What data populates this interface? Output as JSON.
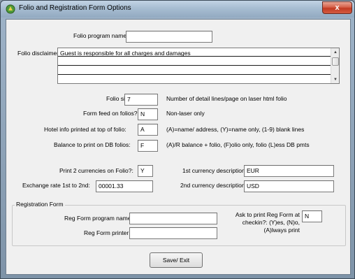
{
  "window": {
    "title": "Folio and Registration Form Options",
    "close_glyph": "x"
  },
  "folio_program_name": {
    "label": "Folio program name:",
    "value": ""
  },
  "folio_disclaimer": {
    "label": "Folio disclaimer:",
    "lines": [
      "Guest is responsible for all charges and damages",
      "",
      "",
      ""
    ]
  },
  "folio_size": {
    "label": "Folio size:",
    "value": "7",
    "hint": "Number of detail lines/page on laser html folio"
  },
  "form_feed": {
    "label": "Form feed on folios?:",
    "value": "N",
    "hint": "Non-laser only"
  },
  "hotel_info": {
    "label": "Hotel info printed at top of folio:",
    "value": "A",
    "hint": "(A)=name/ address, (Y)=name only, (1-9) blank lines"
  },
  "balance": {
    "label": "Balance to print on DB folios:",
    "value": "F",
    "hint": "(A)/R balance + folio, (F)olio only, folio (L)ess DB pmts"
  },
  "print_2_currencies": {
    "label": "Print 2 currencies on Folio?:",
    "value": "Y"
  },
  "exchange_rate": {
    "label": "Exchange rate 1st to 2nd:",
    "value": "00001.33"
  },
  "currency1": {
    "label": "1st currency description:",
    "value": "EUR"
  },
  "currency2": {
    "label": "2nd currency description",
    "value": "USD"
  },
  "registration_form": {
    "legend": "Registration Form",
    "program_name": {
      "label": "Reg Form program name:",
      "value": ""
    },
    "printer": {
      "label": "Reg Form printer:",
      "value": ""
    },
    "ask_print": {
      "label_lines": [
        "Ask to print Reg Form at",
        "checkin?: (Y)es, (N)o,",
        "(A)lways print"
      ],
      "value": "N"
    }
  },
  "save_button": {
    "label": "Save/ Exit"
  },
  "icons": {
    "app": "app-icon",
    "scroll_up": "scroll-up-icon",
    "scroll_down": "scroll-down-icon"
  }
}
